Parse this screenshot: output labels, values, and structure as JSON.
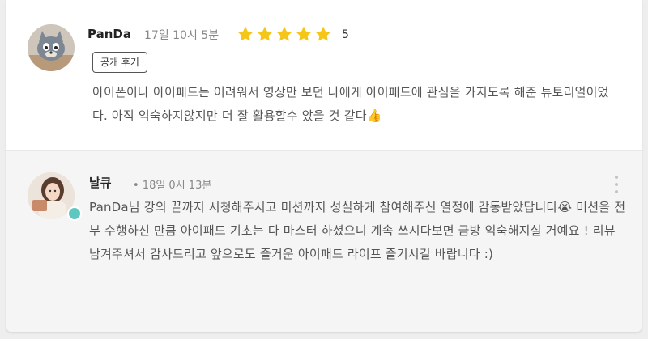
{
  "review": {
    "author": "PanDa",
    "date": "17일 10시 5분",
    "rating": 5,
    "rating_label": "5",
    "badge": "공개 후기",
    "text": "아이폰이나 아이패드는 어려워서 영상만 보던 나에게 아이패드에 관심을 가지도록 해준 튜토리얼이었다. 아직 익숙하지않지만 더 잘 활용할수 았을 것 같다👍"
  },
  "reply": {
    "author": "날큐",
    "date": "• 18일 0시 13분",
    "text": "PanDa님 강의 끝까지 시청해주시고 미션까지 성실하게 참여해주신 열정에 감동받았답니다😭  미션을 전부 수행하신 만큼 아이패드 기초는 다 마스터 하셨으니 계속 쓰시다보면 금방 익숙해지실 거예요 ! 리뷰 남겨주셔서 감사드리고 앞으로도 즐거운 아이패드 라이프 즐기시길 바랍니다 :)"
  },
  "colors": {
    "star": "#f5c518",
    "staff_badge": "#5ec7c0",
    "reply_bg": "#f5f5f5"
  },
  "icons": {
    "review_avatar": "cartoon-cat-avatar",
    "reply_avatar": "instructor-photo-avatar",
    "star": "star-icon",
    "more": "more-vertical-icon"
  }
}
